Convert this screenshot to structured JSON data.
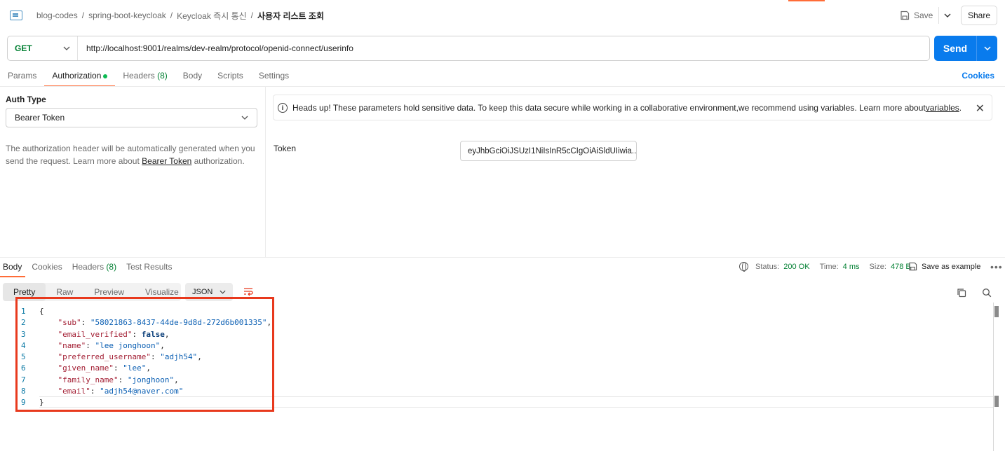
{
  "breadcrumb": {
    "items": [
      "blog-codes",
      "spring-boot-keycloak",
      "Keycloak 즉시 통신"
    ],
    "separator": "/",
    "current": "사용자 리스트 조회"
  },
  "header": {
    "save_label": "Save",
    "share_label": "Share"
  },
  "request": {
    "method": "GET",
    "url": "http://localhost:9001/realms/dev-realm/protocol/openid-connect/userinfo",
    "send_label": "Send"
  },
  "request_tabs": {
    "params": "Params",
    "authorization": "Authorization",
    "headers": "Headers",
    "headers_count": "(8)",
    "body": "Body",
    "scripts": "Scripts",
    "settings": "Settings",
    "cookies": "Cookies"
  },
  "auth": {
    "type_label": "Auth Type",
    "type_value": "Bearer Token",
    "desc_prefix": "The authorization header will be automatically generated when you send the request. Learn more about ",
    "desc_link": "Bearer Token",
    "desc_suffix": " authorization.",
    "banner_text": "Heads up! These parameters hold sensitive data. To keep this data secure while working in a collaborative environment,we recommend using variables. Learn more about ",
    "banner_link": "variables",
    "banner_end": ".",
    "token_label": "Token",
    "token_value": "eyJhbGciOiJSUzI1NiIsInR5cCIgOiAiSldUIiwia..."
  },
  "response_tabs": {
    "body": "Body",
    "cookies": "Cookies",
    "headers": "Headers",
    "headers_count": "(8)",
    "test_results": "Test Results"
  },
  "response_meta": {
    "status_label": "Status:",
    "status_value": "200 OK",
    "time_label": "Time:",
    "time_value": "4 ms",
    "size_label": "Size:",
    "size_value": "478 B",
    "save_example": "Save as example"
  },
  "format": {
    "pretty": "Pretty",
    "raw": "Raw",
    "preview": "Preview",
    "visualize": "Visualize",
    "language": "JSON"
  },
  "code_lines": [
    {
      "n": "1",
      "open": "{"
    },
    {
      "n": "2",
      "key": "\"sub\"",
      "value": "\"58021863-8437-44de-9d8d-272d6b001335\"",
      "type": "str"
    },
    {
      "n": "3",
      "key": "\"email_verified\"",
      "value": "false",
      "type": "bool"
    },
    {
      "n": "4",
      "key": "\"name\"",
      "value": "\"lee jonghoon\"",
      "type": "str"
    },
    {
      "n": "5",
      "key": "\"preferred_username\"",
      "value": "\"adjh54\"",
      "type": "str"
    },
    {
      "n": "6",
      "key": "\"given_name\"",
      "value": "\"lee\"",
      "type": "str"
    },
    {
      "n": "7",
      "key": "\"family_name\"",
      "value": "\"jonghoon\"",
      "type": "str"
    },
    {
      "n": "8",
      "key": "\"email\"",
      "value": "\"adjh54@naver.com\"",
      "type": "str",
      "last": true
    },
    {
      "n": "9",
      "open": "}"
    }
  ],
  "colors": {
    "accent": "#ff6c37",
    "send": "#097bed",
    "method": "#007f31",
    "highlight": "#e8391d"
  }
}
